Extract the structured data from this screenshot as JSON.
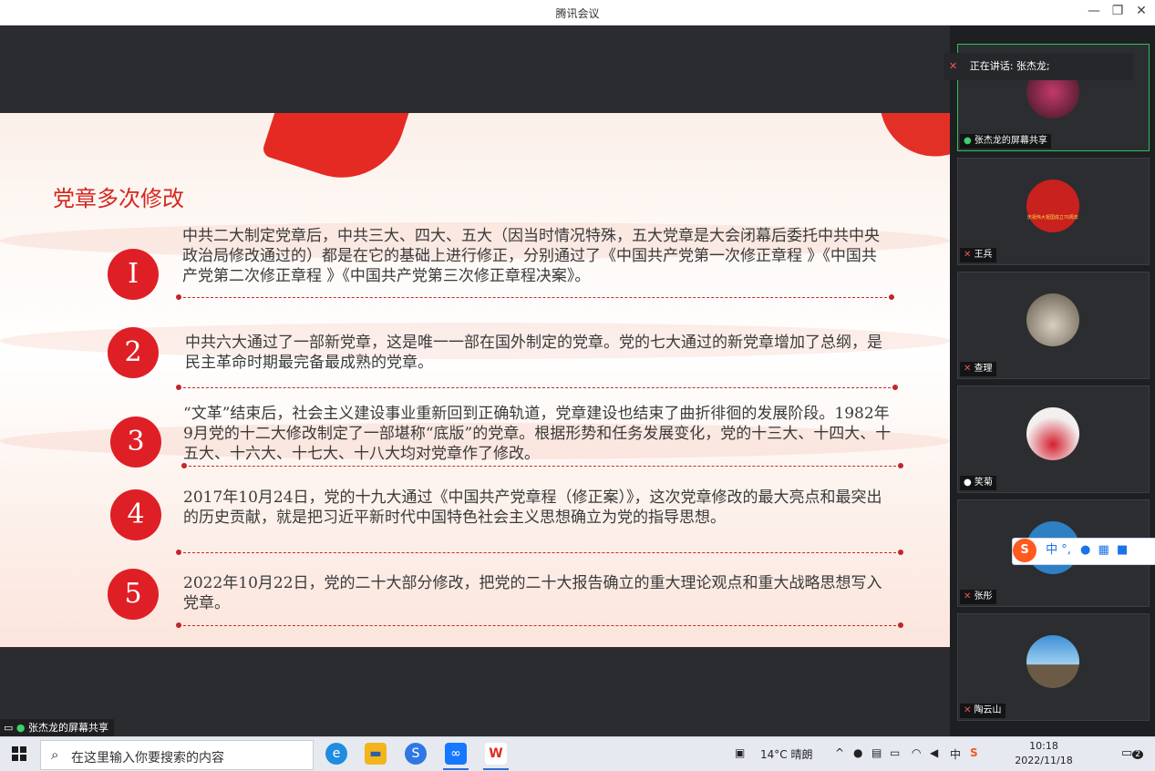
{
  "window": {
    "title": "腾讯会议",
    "minimize": "—",
    "restore": "❐",
    "close": "✕"
  },
  "slide": {
    "title": "党章多次修改",
    "items": [
      {
        "num": "I",
        "text": "中共二大制定党章后，中共三大、四大、五大（因当时情况特殊，五大党章是大会闭幕后委托中共中央政治局修改通过的）都是在它的基础上进行修正，分别通过了《中国共产党第一次修正章程 》《中国共产党第二次修正章程 》《中国共产党第三次修正章程决案》。"
      },
      {
        "num": "2",
        "text": "中共六大通过了一部新党章，这是唯一一部在国外制定的党章。党的七大通过的新党章增加了总纲，是民主革命时期最完备最成熟的党章。"
      },
      {
        "num": "3",
        "text": "“文革”结束后，社会主义建设事业重新回到正确轨道，党章建设也结束了曲折徘徊的发展阶段。1982年9月党的十二大修改制定了一部堪称“底版”的党章。根据形势和任务发展变化，党的十三大、十四大、十五大、十六大、十七大、十八大均对党章作了修改。"
      },
      {
        "num": "4",
        "text": "2017年10月24日，党的十九大通过《中国共产党章程（修正案）》，这次党章修改的最大亮点和最突出的历史贡献，就是把习近平新时代中国特色社会主义思想确立为党的指导思想。"
      },
      {
        "num": "5",
        "text": "2022年10月22日，党的二十大部分修改，把党的二十大报告确立的重大理论观点和重大战略思想写入党章。"
      }
    ]
  },
  "share_label": "张杰龙的屏幕共享",
  "speaking": {
    "text": "正在讲话: 张杰龙;"
  },
  "participants": [
    {
      "name": "张杰龙的屏幕共享",
      "avatar_color": "#6a1f2e",
      "active": true,
      "mic": "on"
    },
    {
      "name": "王兵",
      "avatar_color": "#c8211e",
      "active": false,
      "mic": "muted",
      "avatar_text": "庆祝伟大祖国成立70周年"
    },
    {
      "name": "查理",
      "avatar_color": "#8a8068",
      "active": false,
      "mic": "muted"
    },
    {
      "name": "笑菊",
      "avatar_color": "#e8e4e4",
      "active": false,
      "mic": "on"
    },
    {
      "name": "张彤",
      "avatar_color": "#2f7fc4",
      "active": false,
      "mic": "muted"
    },
    {
      "name": "陶云山",
      "avatar_color": "#7fb6e0",
      "active": false,
      "mic": "muted"
    }
  ],
  "ime": {
    "logo": "S",
    "label": "中 °,"
  },
  "taskbar": {
    "search_placeholder": "在这里输入你要搜索的内容",
    "weather": "14°C 晴朗",
    "ime_indicator": "中",
    "time": "10:18",
    "date": "2022/11/18",
    "notification_count": "2"
  }
}
